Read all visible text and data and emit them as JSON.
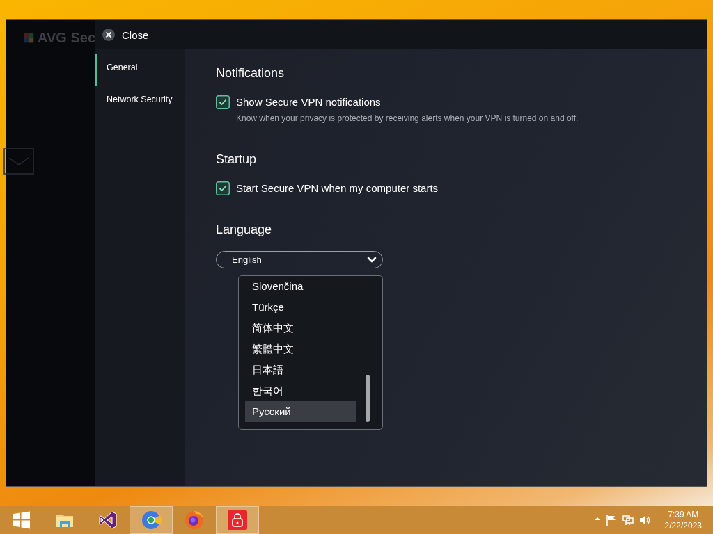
{
  "background_app": {
    "title": "AVG Sec"
  },
  "close_button": {
    "label": "Close"
  },
  "nav": [
    {
      "label": "General",
      "selected": true
    },
    {
      "label": "Network Security",
      "selected": false
    }
  ],
  "sections": [
    {
      "title": "Notifications",
      "options": [
        {
          "label": "Show Secure VPN notifications",
          "description": "Know when your privacy is protected by receiving alerts when your VPN is turned on and off.",
          "checked": true
        }
      ]
    },
    {
      "title": "Startup",
      "options": [
        {
          "label": "Start Secure VPN when my computer starts",
          "checked": true
        }
      ]
    }
  ],
  "language": {
    "title": "Language",
    "value": "English",
    "expanded": true,
    "options": [
      {
        "label": "Slovenčina",
        "highlighted": false
      },
      {
        "label": "Türkçe",
        "highlighted": false
      },
      {
        "label": "简体中文",
        "highlighted": false
      },
      {
        "label": "繁體中文",
        "highlighted": false
      },
      {
        "label": "日本語",
        "highlighted": false
      },
      {
        "label": "한국어",
        "highlighted": false
      },
      {
        "label": "Русский",
        "highlighted": true
      }
    ]
  },
  "taskbar": {
    "apps": [
      {
        "kind": "start",
        "active": false
      },
      {
        "kind": "folder",
        "active": false
      },
      {
        "kind": "studio",
        "active": false
      },
      {
        "kind": "browser",
        "active": true
      },
      {
        "kind": "firefox",
        "active": false
      },
      {
        "kind": "vpn",
        "active": true
      }
    ],
    "tray": [
      {
        "kind": "arrow"
      },
      {
        "kind": "flag"
      },
      {
        "kind": "network"
      },
      {
        "kind": "speaker"
      }
    ],
    "time": "7:39 AM",
    "date": "2/22/2023"
  }
}
